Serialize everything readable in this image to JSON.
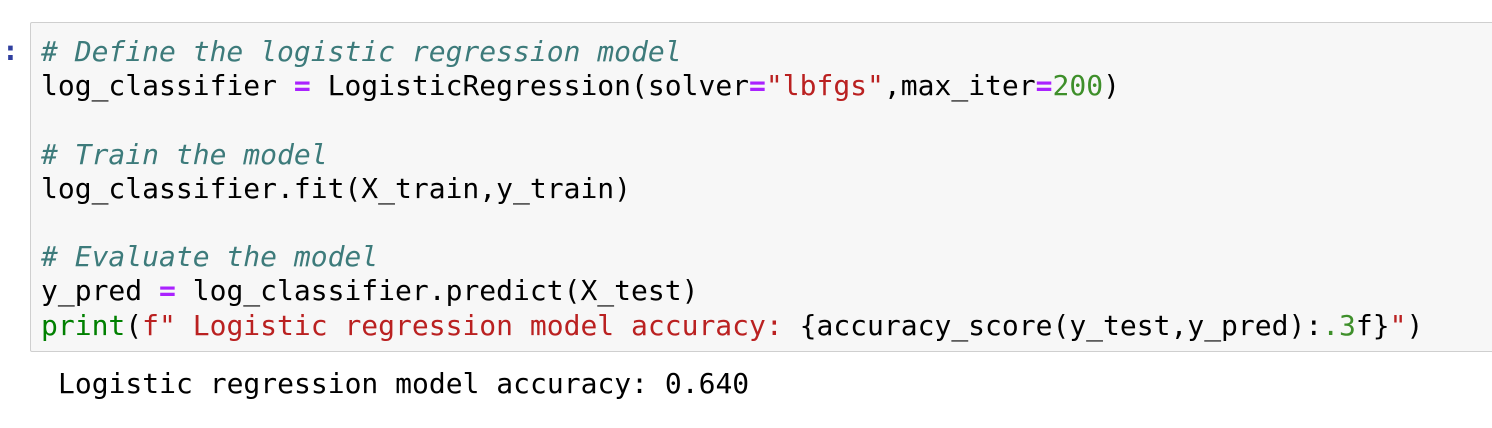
{
  "cell": {
    "prompt": ":",
    "code": {
      "line1_comment": "# Define the logistic regression model",
      "line2_var": "log_classifier ",
      "line2_eq": "=",
      "line2_call": " LogisticRegression(solver",
      "line2_eq2": "=",
      "line2_str": "\"lbfgs\"",
      "line2_mid": ",max_iter",
      "line2_eq3": "=",
      "line2_num": "200",
      "line2_close": ")",
      "line4_comment": "# Train the model",
      "line5": "log_classifier.fit(X_train,y_train)",
      "line7_comment": "# Evaluate the model",
      "line8_var": "y_pred ",
      "line8_eq": "=",
      "line8_call": " log_classifier.predict(X_test)",
      "line9_print": "print",
      "line9_open": "(",
      "line9_str": "f\" Logistic regression model accuracy: ",
      "line9_expr": "{accuracy_score(y_test,y_pred):",
      "line9_fmt_num": ".3",
      "line9_fmt_f": "f}",
      "line9_strend": "\"",
      "line9_close": ")"
    },
    "output": "Logistic regression model accuracy: 0.640"
  },
  "colors": {
    "comment": "#3d7b7b",
    "operator": "#aa22ff",
    "string": "#ba2121",
    "number": "#3e8f2a",
    "builtin": "#008000",
    "cell_background": "#f7f7f7",
    "cell_border": "#cfcfcf"
  }
}
